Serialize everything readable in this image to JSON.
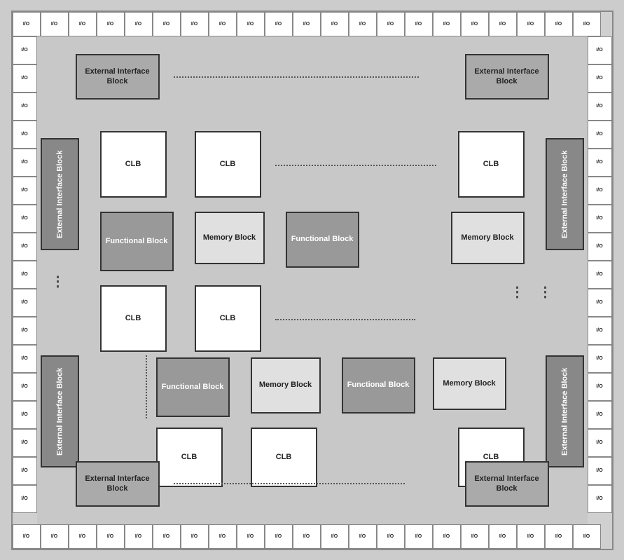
{
  "io_label": "I/O",
  "io_top_count": 21,
  "io_bottom_count": 21,
  "io_left_count": 17,
  "io_right_count": 17,
  "blocks": {
    "ext_top_left": "External Interface Block",
    "ext_top_right": "External Interface Block",
    "ext_mid_left": "External Interface Block",
    "ext_mid_right": "External Interface Block",
    "ext_bot_left": "External Interface Block",
    "ext_bot_right": "External Interface Block",
    "ext_lower_left": "External Interface Block",
    "ext_lower_right": "External Interface Block",
    "clb": "CLB",
    "functional": "Functional Block",
    "memory": "Memory Block"
  },
  "colors": {
    "io_bg": "#ffffff",
    "clb_bg": "#ffffff",
    "functional_bg": "#999999",
    "memory_bg": "#e0e0e0",
    "ext_light_bg": "#aaaaaa",
    "ext_dark_bg": "#888888",
    "inner_bg": "#c8c8c8"
  }
}
